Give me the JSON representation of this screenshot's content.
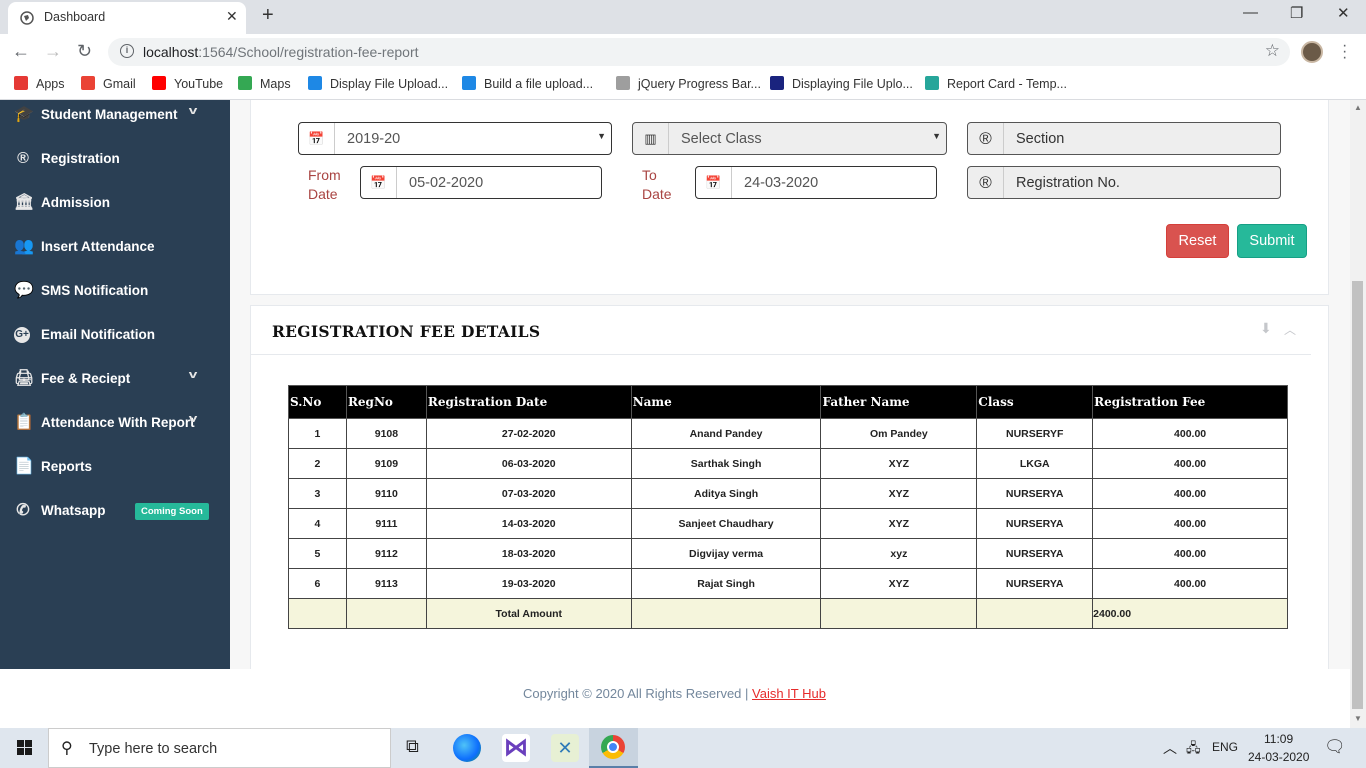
{
  "browser": {
    "tab_title": "Dashboard",
    "url_host": "localhost",
    "url_path": ":1564/School/registration-fee-report",
    "bookmarks": [
      {
        "label": "Apps",
        "color": "#e53935"
      },
      {
        "label": "Gmail",
        "color": "#ea4335"
      },
      {
        "label": "YouTube",
        "color": "#ff0000"
      },
      {
        "label": "Maps",
        "color": "#34a853"
      },
      {
        "label": "Display File Upload...",
        "color": "#1e88e5"
      },
      {
        "label": "Build a file upload...",
        "color": "#1e88e5"
      },
      {
        "label": "jQuery Progress Bar...",
        "color": "#9e9e9e"
      },
      {
        "label": "Displaying File Uplo...",
        "color": "#1a237e"
      },
      {
        "label": "Report Card - Temp...",
        "color": "#26a69a"
      }
    ]
  },
  "sidebar": {
    "items": [
      {
        "label": "Student Management",
        "icon": "graduation-icon"
      },
      {
        "label": "Registration",
        "icon": "registered-icon"
      },
      {
        "label": "Admission",
        "icon": "bank-icon"
      },
      {
        "label": "Insert Attendance",
        "icon": "users-icon"
      },
      {
        "label": "SMS Notification",
        "icon": "chat-icon"
      },
      {
        "label": "Email Notification",
        "icon": "google-plus-icon"
      },
      {
        "label": "Fee & Reciept",
        "icon": "print-icon"
      },
      {
        "label": "Attendance With Report",
        "icon": "clipboard-icon"
      },
      {
        "label": "Reports",
        "icon": "file-icon"
      },
      {
        "label": "Whatsapp",
        "icon": "whatsapp-icon"
      }
    ],
    "whatsapp_badge": "Coming Soon"
  },
  "filters": {
    "session": "2019-20",
    "class_placeholder": "Select Class",
    "section_placeholder": "Section",
    "regno_placeholder": "Registration No.",
    "from_label_1": "From",
    "from_label_2": "Date",
    "from_date": "05-02-2020",
    "to_label_1": "To",
    "to_label_2": "Date",
    "to_date": "24-03-2020",
    "reset_label": "Reset",
    "submit_label": "Submit"
  },
  "details": {
    "title": "REGISTRATION FEE DETAILS",
    "columns": [
      "S.No",
      "RegNo",
      "Registration Date",
      "Name",
      "Father Name",
      "Class",
      "Registration Fee"
    ],
    "rows": [
      [
        "1",
        "9108",
        "27-02-2020",
        "Anand Pandey",
        "Om Pandey",
        "NURSERYF",
        "400.00"
      ],
      [
        "2",
        "9109",
        "06-03-2020",
        "Sarthak Singh",
        "XYZ",
        "LKGA",
        "400.00"
      ],
      [
        "3",
        "9110",
        "07-03-2020",
        "Aditya Singh",
        "XYZ",
        "NURSERYA",
        "400.00"
      ],
      [
        "4",
        "9111",
        "14-03-2020",
        "Sanjeet Chaudhary",
        "XYZ",
        "NURSERYA",
        "400.00"
      ],
      [
        "5",
        "9112",
        "18-03-2020",
        "Digvijay verma",
        "xyz",
        "NURSERYA",
        "400.00"
      ],
      [
        "6",
        "9113",
        "19-03-2020",
        "Rajat Singh",
        "XYZ",
        "NURSERYA",
        "400.00"
      ]
    ],
    "total_label": "Total Amount",
    "total_value": "2400.00"
  },
  "footer": {
    "copyright": "Copyright © 2020 All Rights Reserved | ",
    "link": "Vaish IT Hub"
  },
  "taskbar": {
    "search_placeholder": "Type here to search",
    "language": "ENG",
    "time": "11:09",
    "date": "24-03-2020"
  }
}
